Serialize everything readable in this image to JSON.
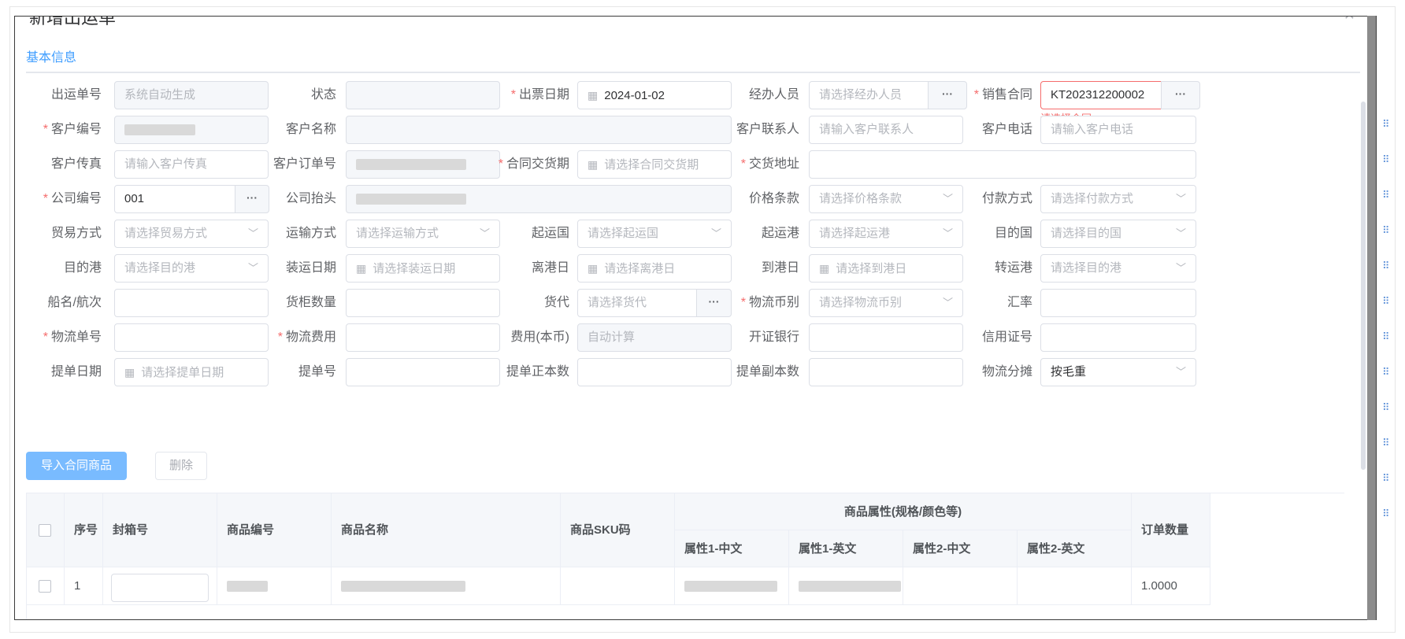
{
  "dialog": {
    "title": "新增出运单",
    "close_icon": "close-icon"
  },
  "tabs": [
    {
      "label": "基本信息"
    }
  ],
  "form": {
    "shipment_no": {
      "label": "出运单号",
      "placeholder": "系统自动生成"
    },
    "status": {
      "label": "状态"
    },
    "ticket_date": {
      "label": "出票日期",
      "value": "2024-01-02"
    },
    "handler": {
      "label": "经办人员",
      "placeholder": "请选择经办人员"
    },
    "sales_contract": {
      "label": "销售合同",
      "value": "KT202312200002",
      "error": "请选择合同"
    },
    "customer_code": {
      "label": "客户编号"
    },
    "customer_name": {
      "label": "客户名称"
    },
    "customer_contact": {
      "label": "客户联系人",
      "placeholder": "请输入客户联系人"
    },
    "customer_phone": {
      "label": "客户电话",
      "placeholder": "请输入客户电话"
    },
    "customer_fax": {
      "label": "客户传真",
      "placeholder": "请输入客户传真"
    },
    "customer_order_no": {
      "label": "客户订单号"
    },
    "contract_delivery": {
      "label": "合同交货期",
      "placeholder": "请选择合同交货期"
    },
    "delivery_address": {
      "label": "交货地址"
    },
    "company_code": {
      "label": "公司编号",
      "value": "001"
    },
    "company_header": {
      "label": "公司抬头"
    },
    "price_terms": {
      "label": "价格条款",
      "placeholder": "请选择价格条款"
    },
    "payment_method": {
      "label": "付款方式",
      "placeholder": "请选择付款方式"
    },
    "trade_method": {
      "label": "贸易方式",
      "placeholder": "请选择贸易方式"
    },
    "transport_method": {
      "label": "运输方式",
      "placeholder": "请选择运输方式"
    },
    "origin_country": {
      "label": "起运国",
      "placeholder": "请选择起运国"
    },
    "origin_port": {
      "label": "起运港",
      "placeholder": "请选择起运港"
    },
    "dest_country": {
      "label": "目的国",
      "placeholder": "请选择目的国"
    },
    "dest_port": {
      "label": "目的港",
      "placeholder": "请选择目的港"
    },
    "loading_date": {
      "label": "装运日期",
      "placeholder": "请选择装运日期"
    },
    "departure_date": {
      "label": "离港日",
      "placeholder": "请选择离港日"
    },
    "arrival_date": {
      "label": "到港日",
      "placeholder": "请选择到港日"
    },
    "transit_port": {
      "label": "转运港",
      "placeholder": "请选择目的港"
    },
    "vessel": {
      "label": "船名/航次"
    },
    "container_qty": {
      "label": "货柜数量"
    },
    "forwarder": {
      "label": "货代",
      "placeholder": "请选择货代"
    },
    "logistics_currency": {
      "label": "物流币别",
      "placeholder": "请选择物流币别"
    },
    "exchange_rate": {
      "label": "汇率"
    },
    "logistics_no": {
      "label": "物流单号"
    },
    "logistics_fee": {
      "label": "物流费用"
    },
    "fee_local": {
      "label": "费用(本币)",
      "placeholder": "自动计算"
    },
    "issuing_bank": {
      "label": "开证银行"
    },
    "lc_no": {
      "label": "信用证号"
    },
    "bl_date": {
      "label": "提单日期",
      "placeholder": "请选择提单日期"
    },
    "bl_no": {
      "label": "提单号"
    },
    "bl_originals": {
      "label": "提单正本数"
    },
    "bl_copies": {
      "label": "提单副本数"
    },
    "logistics_split": {
      "label": "物流分摊",
      "value": "按毛重"
    }
  },
  "actions": {
    "import_label": "导入合同商品",
    "delete_label": "删除"
  },
  "table": {
    "headers": {
      "seq": "序号",
      "box_no": "封箱号",
      "product_code": "商品编号",
      "product_name": "商品名称",
      "sku": "商品SKU码",
      "attrs_group": "商品属性(规格/颜色等)",
      "attr1_cn": "属性1-中文",
      "attr1_en": "属性1-英文",
      "attr2_cn": "属性2-中文",
      "attr2_en": "属性2-英文",
      "order_qty": "订单数量"
    },
    "rows": [
      {
        "seq": "1",
        "order_qty": "1.0000"
      }
    ]
  }
}
